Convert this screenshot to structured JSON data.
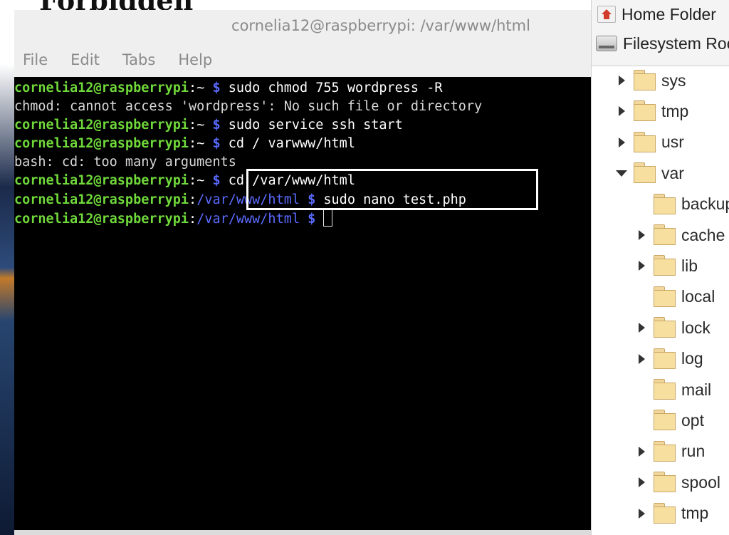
{
  "background": {
    "partial_heading": "Forbidden"
  },
  "terminal": {
    "title": "cornelia12@raspberrypi: /var/www/html",
    "menu": [
      "File",
      "Edit",
      "Tabs",
      "Help"
    ],
    "prompt_user": "cornelia12@raspberrypi",
    "lines": [
      {
        "path": "~",
        "command": "sudo chmod 755 wordpress -R"
      },
      {
        "output": "chmod: cannot access 'wordpress': No such file or directory"
      },
      {
        "path": "~",
        "command": "sudo service ssh start"
      },
      {
        "path": "~",
        "command": "cd / varwww/html"
      },
      {
        "output": "bash: cd: too many arguments"
      },
      {
        "path": "~",
        "command": "cd /var/www/html"
      },
      {
        "path": "/var/www/html",
        "command": "sudo nano test.php"
      },
      {
        "path": "/var/www/html",
        "command": ""
      }
    ]
  },
  "file_manager": {
    "places": [
      {
        "label": "Home Folder",
        "icon": "home-icon"
      },
      {
        "label": "Filesystem Root",
        "icon": "drive-icon"
      }
    ],
    "tree": [
      {
        "label": "sys",
        "level": 0,
        "expander": "collapsed"
      },
      {
        "label": "tmp",
        "level": 0,
        "expander": "collapsed"
      },
      {
        "label": "usr",
        "level": 0,
        "expander": "collapsed"
      },
      {
        "label": "var",
        "level": 0,
        "expander": "expanded"
      },
      {
        "label": "backups",
        "level": 1,
        "expander": "none"
      },
      {
        "label": "cache",
        "level": 1,
        "expander": "collapsed"
      },
      {
        "label": "lib",
        "level": 1,
        "expander": "collapsed"
      },
      {
        "label": "local",
        "level": 1,
        "expander": "none"
      },
      {
        "label": "lock",
        "level": 1,
        "expander": "collapsed"
      },
      {
        "label": "log",
        "level": 1,
        "expander": "collapsed"
      },
      {
        "label": "mail",
        "level": 1,
        "expander": "none"
      },
      {
        "label": "opt",
        "level": 1,
        "expander": "none"
      },
      {
        "label": "run",
        "level": 1,
        "expander": "collapsed"
      },
      {
        "label": "spool",
        "level": 1,
        "expander": "collapsed"
      },
      {
        "label": "tmp",
        "level": 1,
        "expander": "collapsed"
      }
    ]
  }
}
